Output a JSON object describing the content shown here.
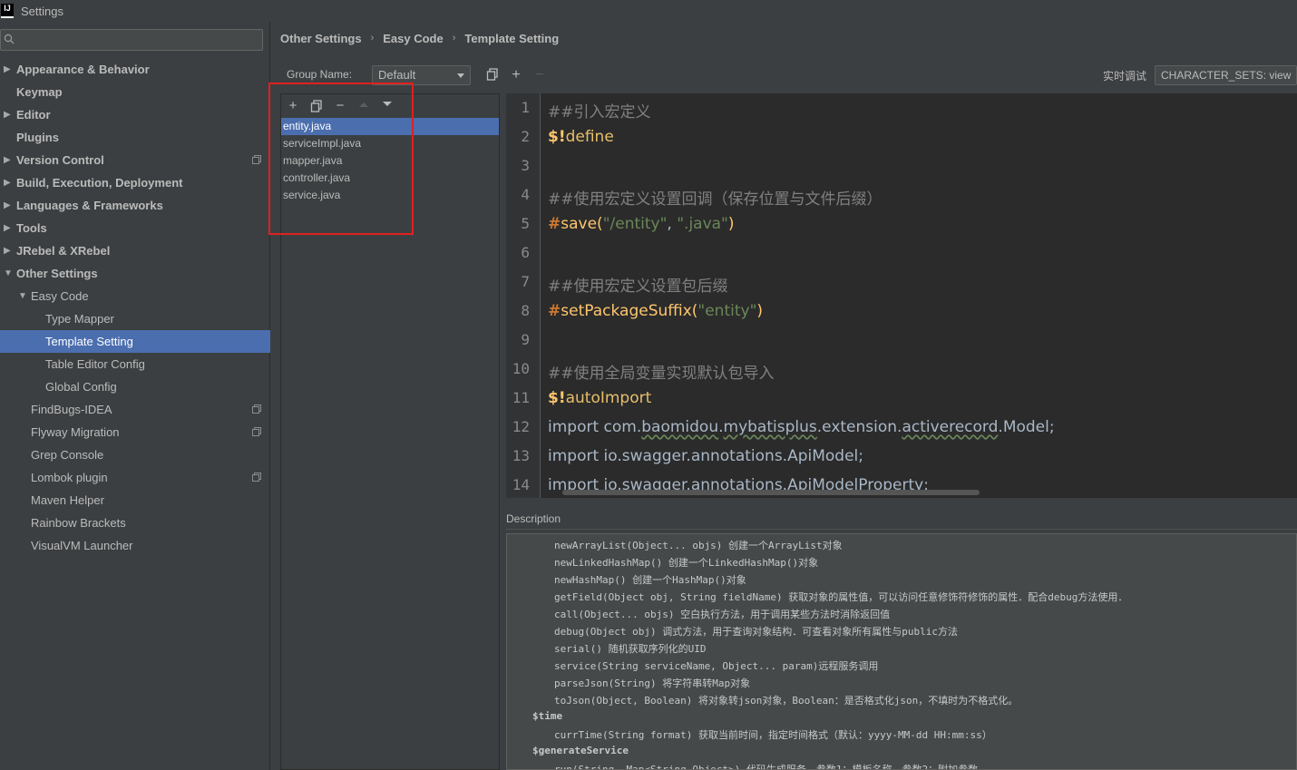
{
  "window": {
    "title": "Settings",
    "app_icon_text": "IJ"
  },
  "sidebar": {
    "search_placeholder": "",
    "items": [
      {
        "label": "Appearance & Behavior",
        "level": 0,
        "bold": true,
        "expandable": true,
        "expanded": false
      },
      {
        "label": "Keymap",
        "level": 0,
        "bold": true
      },
      {
        "label": "Editor",
        "level": 0,
        "bold": true,
        "expandable": true,
        "expanded": false
      },
      {
        "label": "Plugins",
        "level": 0,
        "bold": true
      },
      {
        "label": "Version Control",
        "level": 0,
        "bold": true,
        "expandable": true,
        "expanded": false,
        "project_icon": true
      },
      {
        "label": "Build, Execution, Deployment",
        "level": 0,
        "bold": true,
        "expandable": true,
        "expanded": false
      },
      {
        "label": "Languages & Frameworks",
        "level": 0,
        "bold": true,
        "expandable": true,
        "expanded": false
      },
      {
        "label": "Tools",
        "level": 0,
        "bold": true,
        "expandable": true,
        "expanded": false
      },
      {
        "label": "JRebel & XRebel",
        "level": 0,
        "bold": true,
        "expandable": true,
        "expanded": false
      },
      {
        "label": "Other Settings",
        "level": 0,
        "bold": true,
        "expandable": true,
        "expanded": true
      },
      {
        "label": "Easy Code",
        "level": 1,
        "expandable": true,
        "expanded": true
      },
      {
        "label": "Type Mapper",
        "level": 2
      },
      {
        "label": "Template Setting",
        "level": 2,
        "selected": true
      },
      {
        "label": "Table Editor Config",
        "level": 2
      },
      {
        "label": "Global Config",
        "level": 2
      },
      {
        "label": "FindBugs-IDEA",
        "level": 1,
        "project_icon": true
      },
      {
        "label": "Flyway Migration",
        "level": 1,
        "project_icon": true
      },
      {
        "label": "Grep Console",
        "level": 1
      },
      {
        "label": "Lombok plugin",
        "level": 1,
        "project_icon": true
      },
      {
        "label": "Maven Helper",
        "level": 1
      },
      {
        "label": "Rainbow Brackets",
        "level": 1
      },
      {
        "label": "VisualVM Launcher",
        "level": 1
      }
    ]
  },
  "breadcrumb": [
    "Other Settings",
    "Easy Code",
    "Template Setting"
  ],
  "group": {
    "label": "Group Name:",
    "value": "Default"
  },
  "realtime": {
    "label": "实时调试",
    "value": "CHARACTER_SETS: view"
  },
  "files": {
    "items": [
      "entity.java",
      "serviceImpl.java",
      "mapper.java",
      "controller.java",
      "service.java"
    ],
    "selected_index": 0
  },
  "editor": {
    "line_numbers": [
      "1",
      "2",
      "3",
      "4",
      "5",
      "6",
      "7",
      "8",
      "9",
      "10",
      "11",
      "12",
      "13",
      "14"
    ],
    "lines": [
      [
        {
          "t": "##引入宏定义",
          "c": "c-comment"
        }
      ],
      [
        {
          "t": "$!",
          "c": "c-dollar"
        },
        {
          "t": "define",
          "c": "c-directive"
        }
      ],
      [],
      [
        {
          "t": "##使用宏定义设置回调（保存位置与文件后缀）",
          "c": "c-comment"
        }
      ],
      [
        {
          "t": "#",
          "c": "c-hash"
        },
        {
          "t": "save",
          "c": "c-func"
        },
        {
          "t": "(",
          "c": "c-paren"
        },
        {
          "t": "\"/entity\"",
          "c": "c-string"
        },
        {
          "t": ", ",
          "c": "c-plain"
        },
        {
          "t": "\".java\"",
          "c": "c-string"
        },
        {
          "t": ")",
          "c": "c-paren"
        }
      ],
      [],
      [
        {
          "t": "##使用宏定义设置包后缀",
          "c": "c-comment"
        }
      ],
      [
        {
          "t": "#",
          "c": "c-hash"
        },
        {
          "t": "setPackageSuffix",
          "c": "c-func"
        },
        {
          "t": "(",
          "c": "c-paren"
        },
        {
          "t": "\"entity\"",
          "c": "c-string"
        },
        {
          "t": ")",
          "c": "c-paren"
        }
      ],
      [],
      [
        {
          "t": "##使用全局变量实现默认包导入",
          "c": "c-comment"
        }
      ],
      [
        {
          "t": "$!",
          "c": "c-dollar"
        },
        {
          "t": "autoImport",
          "c": "c-directive"
        }
      ],
      [
        {
          "t": "import com.",
          "c": "c-plain"
        },
        {
          "t": "baomidou",
          "c": "c-plain squiggle"
        },
        {
          "t": ".",
          "c": "c-plain"
        },
        {
          "t": "mybatisplus",
          "c": "c-plain squiggle"
        },
        {
          "t": ".extension.",
          "c": "c-plain"
        },
        {
          "t": "activerecord",
          "c": "c-plain squiggle"
        },
        {
          "t": ".Model;",
          "c": "c-plain"
        }
      ],
      [
        {
          "t": "import io.swagger.annotations.ApiModel;",
          "c": "c-plain"
        }
      ],
      [
        {
          "t": "import io.swagger.annotations.ApiModelProperty;",
          "c": "c-plain"
        }
      ]
    ]
  },
  "description": {
    "label": "Description",
    "lines": [
      {
        "t": "newArrayList(Object... objs) 创建一个ArrayList对象",
        "k": "indent"
      },
      {
        "t": "newLinkedHashMap() 创建一个LinkedHashMap()对象",
        "k": "indent"
      },
      {
        "t": "newHashMap() 创建一个HashMap()对象",
        "k": "indent"
      },
      {
        "t": "getField(Object obj, String fieldName) 获取对象的属性值，可以访问任意修饰符修饰的属性．配合debug方法使用．",
        "k": "indent"
      },
      {
        "t": "call(Object... objs) 空白执行方法，用于调用某些方法时消除返回值",
        "k": "indent"
      },
      {
        "t": "debug(Object obj) 调式方法，用于查询对象结构．可查看对象所有属性与public方法",
        "k": "indent"
      },
      {
        "t": "serial() 随机获取序列化的UID",
        "k": "indent"
      },
      {
        "t": "service(String serviceName, Object... param)远程服务调用",
        "k": "indent"
      },
      {
        "t": "parseJson(String) 将字符串转Map对象",
        "k": "indent"
      },
      {
        "t": "toJson(Object, Boolean) 将对象转json对象，Boolean：是否格式化json，不填时为不格式化。",
        "k": "indent"
      },
      {
        "t": "$time",
        "k": "root"
      },
      {
        "t": "currTime(String format) 获取当前时间，指定时间格式（默认：yyyy-MM-dd HH:mm:ss）",
        "k": "indent"
      },
      {
        "t": "$generateService",
        "k": "root"
      },
      {
        "t": "run(String, Map<String,Object>) 代码生成服务，参数1：模板名称，参数2：附加参数。",
        "k": "indent"
      }
    ]
  }
}
